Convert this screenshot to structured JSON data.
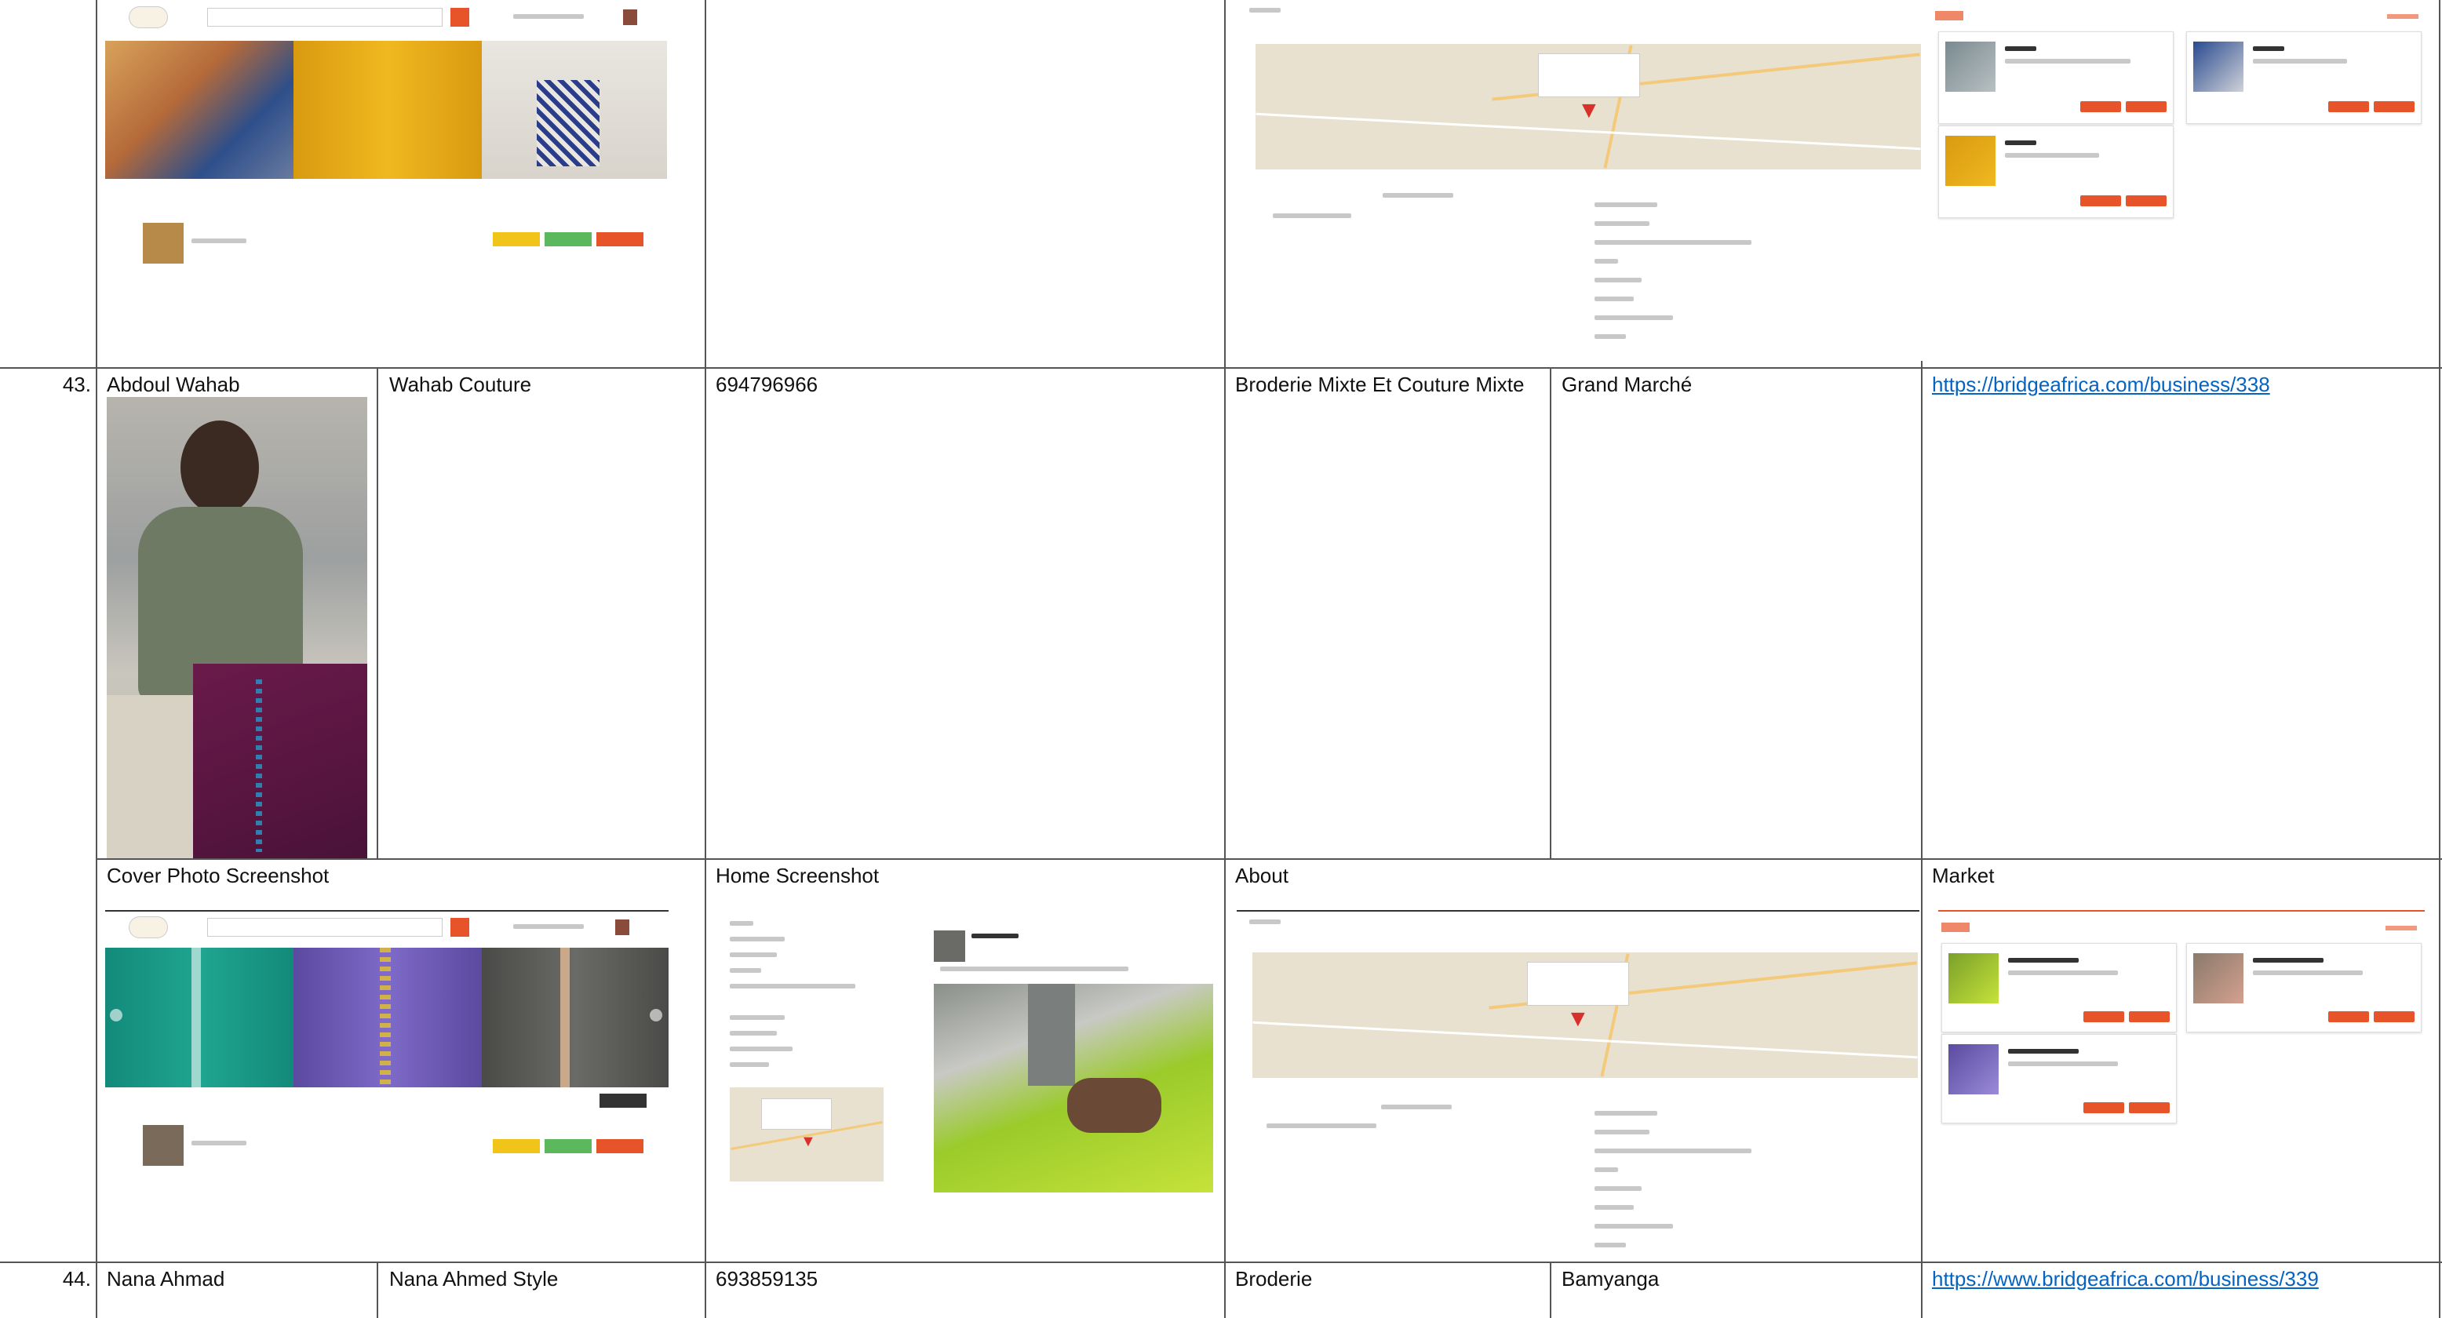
{
  "rows": [
    {
      "number": "43.",
      "owner_name": "Abdoul Wahab",
      "business_name": "Wahab Couture",
      "phone": "694796966",
      "category": "Broderie Mixte Et Couture Mixte",
      "location": "Grand Marché",
      "url": "https://bridgeafrica.com/business/338"
    },
    {
      "number": "44.",
      "owner_name": "Nana Ahmad",
      "business_name": "Nana Ahmed Style",
      "phone": "693859135",
      "category": "Broderie",
      "location": "Bamyanga",
      "url": "https://www.bridgeafrica.com/business/339"
    }
  ],
  "section_headers": {
    "cover": "Cover Photo Screenshot",
    "home": "Home Screenshot",
    "about": "About",
    "market": "Market"
  },
  "colors": {
    "accent": "#e8542a",
    "link": "#0563c1",
    "border": "#555555"
  }
}
